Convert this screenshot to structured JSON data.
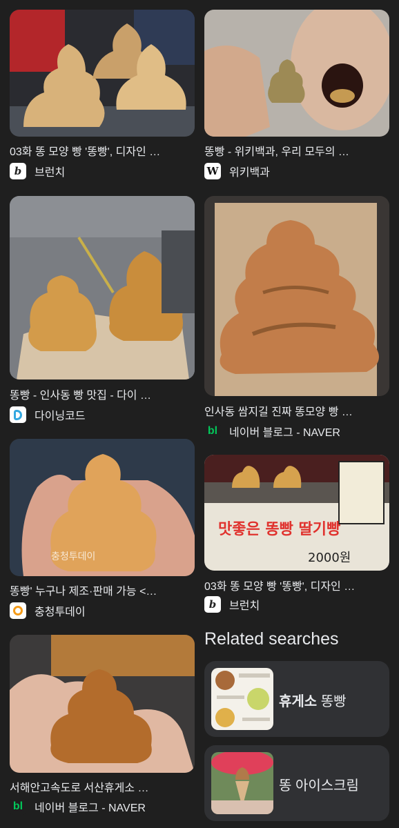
{
  "results": [
    {
      "title": "03화 똥 모양 빵 '똥빵', 디자인 …",
      "source": "브런치",
      "icon": "brunch"
    },
    {
      "title": "똥빵 - 위키백과, 우리 모두의 …",
      "source": "위키백과",
      "icon": "W"
    },
    {
      "title": "똥빵 - 인사동 빵 맛집 - 다이 …",
      "source": "다이닝코드",
      "icon": "diningcode"
    },
    {
      "title": "인사동 쌈지길 진짜 똥모양 빵 …",
      "source": "네이버 블로그 - NAVER",
      "icon": "bl"
    },
    {
      "title": "똥빵' 누구나 제조·판매 가능 <…",
      "source": "충청투데이",
      "icon": "chungcheong"
    },
    {
      "title": "03화 똥 모양 빵 '똥빵', 디자인 …",
      "source": "브런치",
      "icon": "brunch"
    },
    {
      "title": "서해안고속도로 서산휴게소 …",
      "source": "네이버 블로그 - NAVER",
      "icon": "bl"
    }
  ],
  "related": {
    "heading": "Related searches",
    "items": [
      {
        "bold": "휴게소",
        "rest": " 똥빵"
      },
      {
        "bold": "",
        "rest": "똥 아이스크림"
      }
    ]
  },
  "image_text": {
    "watermark": "충청투데이",
    "shop_sign": "맛좋은 똥빵 딸기빵",
    "price": "2000원"
  },
  "colors": {
    "background": "#1f1f1f",
    "card": "#303134",
    "text": "#e8eaed",
    "naver_green": "#03c75a"
  }
}
